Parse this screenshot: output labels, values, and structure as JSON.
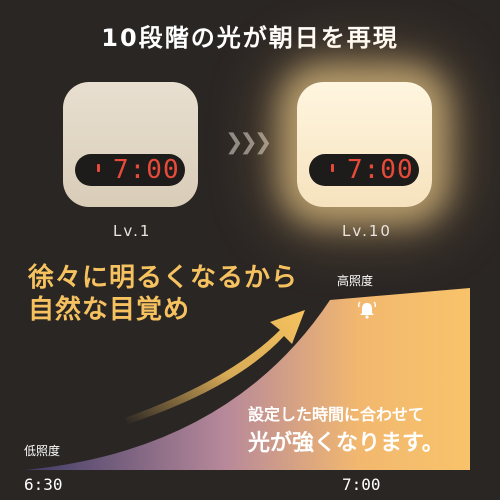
{
  "header": {
    "title": "10段階の光が朝日を再現"
  },
  "devices": [
    {
      "time": "7:00",
      "level": "Lv.1"
    },
    {
      "time": "7:00",
      "level": "Lv.10"
    }
  ],
  "arrow_glyph": "❯❯❯",
  "catchphrase": {
    "line1": "徐々に明るくなるから",
    "line2": "自然な目覚め"
  },
  "graph": {
    "high_label": "高照度",
    "low_label": "低照度",
    "start_time": "6:30",
    "end_time": "7:00",
    "desc_line1": "設定した時間に合わせて",
    "desc_line2": "光が強くなります。",
    "icon": "alarm-bell-icon"
  },
  "colors": {
    "accent": "#f6c25f",
    "digits": "#e84a3a",
    "background": "#2a2624"
  }
}
